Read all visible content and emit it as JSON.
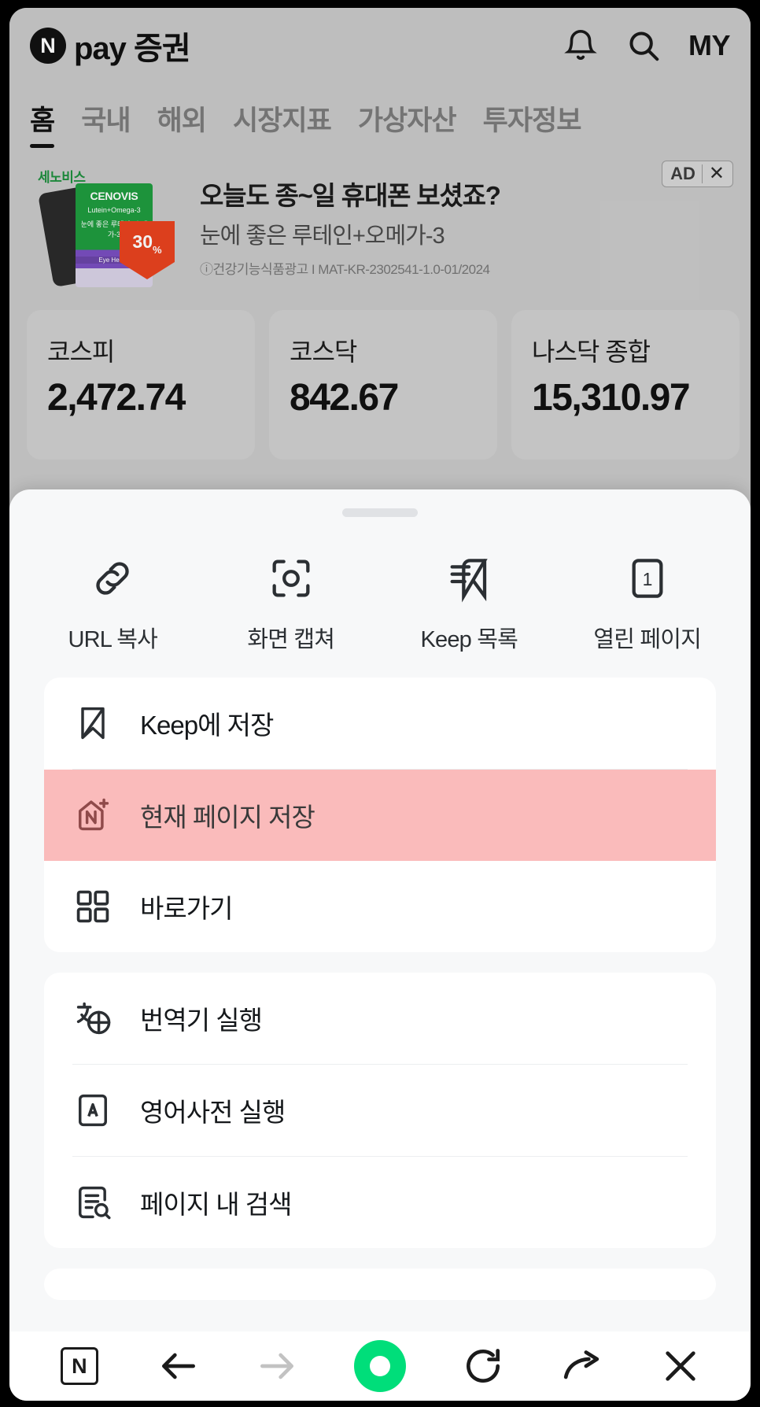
{
  "app": {
    "logo_mark": "N",
    "logo_text": "pay 증권",
    "my_label": "MY",
    "bell_icon": "bell-icon",
    "search_icon": "search-icon"
  },
  "nav": {
    "tabs": [
      {
        "label": "홈",
        "active": true
      },
      {
        "label": "국내",
        "active": false
      },
      {
        "label": "해외",
        "active": false
      },
      {
        "label": "시장지표",
        "active": false
      },
      {
        "label": "가상자산",
        "active": false
      },
      {
        "label": "투자정보",
        "active": false
      }
    ]
  },
  "ad": {
    "brand": "세노비스",
    "product_title": "CENOVIS",
    "product_sub": "Lutein+Omega-3",
    "product_sub2": "눈에 좋은 루테인+오메가-3",
    "product_eye": "Eye Health",
    "discount": "30",
    "discount_unit": "%",
    "headline": "오늘도 종~일 휴대폰 보셨죠?",
    "subline": "눈에 좋은 루테인+오메가-3",
    "fineprint": "ⓘ건강기능식품광고 I MAT-KR-2302541-1.0-01/2024",
    "ad_label": "AD",
    "close_label": "✕"
  },
  "indices": [
    {
      "name": "코스피",
      "value": "2,472.74"
    },
    {
      "name": "코스닥",
      "value": "842.67"
    },
    {
      "name": "나스닥 종합",
      "value": "15,310.97"
    }
  ],
  "sheet": {
    "quick_actions": [
      {
        "label": "URL 복사",
        "icon": "link-icon"
      },
      {
        "label": "화면 캡쳐",
        "icon": "screenshot-icon"
      },
      {
        "label": "Keep 목록",
        "icon": "keep-list-icon"
      },
      {
        "label": "열린 페이지",
        "icon": "open-pages-icon",
        "badge": "1"
      }
    ],
    "group_one": [
      {
        "label": "Keep에 저장",
        "icon": "bookmark-icon",
        "selected": false
      },
      {
        "label": "현재 페이지 저장",
        "icon": "save-page-icon",
        "selected": true
      },
      {
        "label": "바로가기",
        "icon": "shortcut-icon",
        "selected": false
      }
    ],
    "group_two": [
      {
        "label": "번역기 실행",
        "icon": "translate-icon",
        "selected": false
      },
      {
        "label": "영어사전 실행",
        "icon": "dictionary-icon",
        "selected": false
      },
      {
        "label": "페이지 내 검색",
        "icon": "find-in-page-icon",
        "selected": false
      }
    ]
  },
  "bottom_bar": {
    "items": [
      {
        "name": "naver-button",
        "label": "N"
      },
      {
        "name": "back-button",
        "label": "←"
      },
      {
        "name": "forward-button",
        "label": "→"
      },
      {
        "name": "home-button",
        "label": ""
      },
      {
        "name": "reload-button",
        "label": "⟳"
      },
      {
        "name": "share-button",
        "label": "↝"
      },
      {
        "name": "close-button",
        "label": "✕"
      }
    ]
  },
  "colors": {
    "accent_green": "#00de7a",
    "selected_row": "#fabbbb",
    "sheet_bg": "#f7f8f9",
    "brand_green": "#1e8f3e"
  }
}
